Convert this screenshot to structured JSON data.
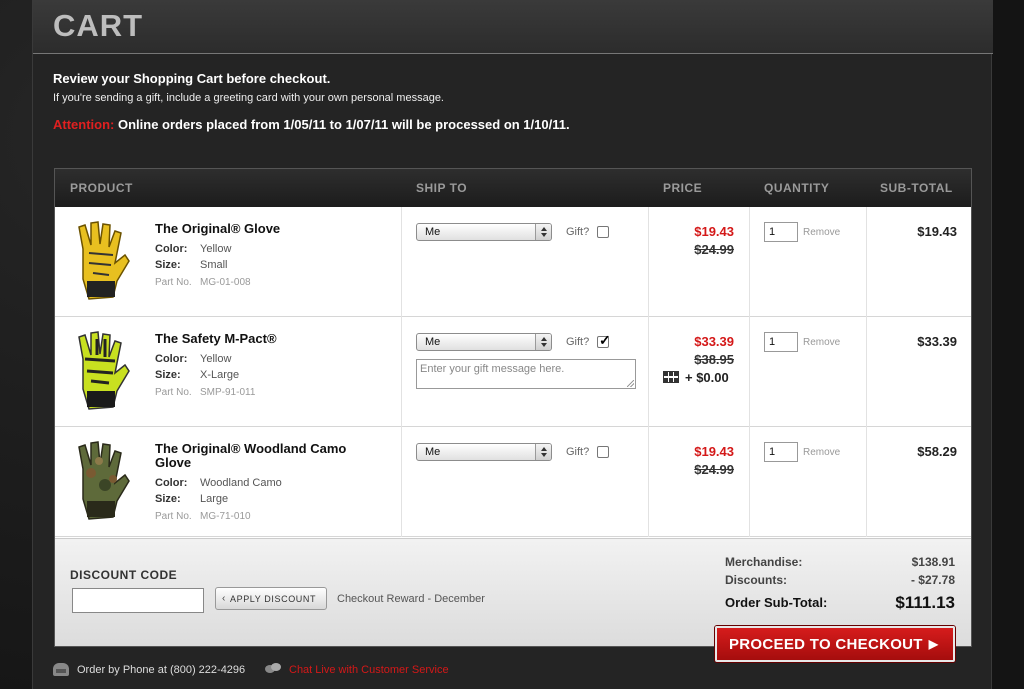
{
  "header": {
    "title": "CART"
  },
  "intro": {
    "title": "Review your Shopping Cart before checkout.",
    "subtitle": "If you're sending a gift, include a greeting card with your own personal message.",
    "attention_label": "Attention:",
    "attention_text": " Online orders placed from 1/05/11 to 1/07/11 will be processed on 1/10/11."
  },
  "table": {
    "columns": [
      "PRODUCT",
      "SHIP TO",
      "PRICE",
      "QUANTITY",
      "SUB-TOTAL"
    ],
    "labels": {
      "color": "Color:",
      "size": "Size:",
      "part": "Part No.",
      "gift": "Gift?",
      "remove": "Remove"
    },
    "rows": [
      {
        "name": "The Original® Glove",
        "color": "Yellow",
        "size": "Small",
        "part": "MG-01-008",
        "ship_to": "Me",
        "gift_checked": false,
        "price_sale": "$19.43",
        "price_orig": "$24.99",
        "qty": "1",
        "subtotal": "$19.43"
      },
      {
        "name": "The Safety M-Pact®",
        "color": "Yellow",
        "size": "X-Large",
        "part": "SMP-91-011",
        "ship_to": "Me",
        "gift_checked": true,
        "gift_message_placeholder": "Enter your gift message here.",
        "price_sale": "$33.39",
        "price_orig": "$38.95",
        "gift_wrap": "+ $0.00",
        "qty": "1",
        "subtotal": "$33.39"
      },
      {
        "name": "The Original® Woodland Camo Glove",
        "color": "Woodland Camo",
        "size": "Large",
        "part": "MG-71-010",
        "ship_to": "Me",
        "gift_checked": false,
        "price_sale": "$19.43",
        "price_orig": "$24.99",
        "qty": "1",
        "subtotal": "$58.29"
      }
    ]
  },
  "discount": {
    "label": "DISCOUNT CODE",
    "value": "",
    "apply_label": "APPLY DISCOUNT",
    "reward": "Checkout Reward - December"
  },
  "summary": {
    "merch_label": "Merchandise:",
    "merch_value": "$138.91",
    "disc_label": "Discounts:",
    "disc_value": "- $27.78",
    "total_label": "Order Sub-Total:",
    "total_value": "$111.13"
  },
  "checkout": {
    "label": "PROCEED TO CHECKOUT"
  },
  "footer": {
    "phone": "Order by Phone at (800) 222-4296",
    "chat": "Chat Live with Customer Service"
  },
  "colors": {
    "accent_red": "#d41818",
    "glove_yellow": "#e8c020",
    "camo": "#5e6a3a"
  },
  "icons": [
    "glove-thumbnail",
    "select-arrow-icon",
    "checkmark-icon",
    "gift-wrap-icon",
    "chevron-left-icon",
    "play-arrow-icon",
    "phone-icon",
    "chat-icon"
  ]
}
